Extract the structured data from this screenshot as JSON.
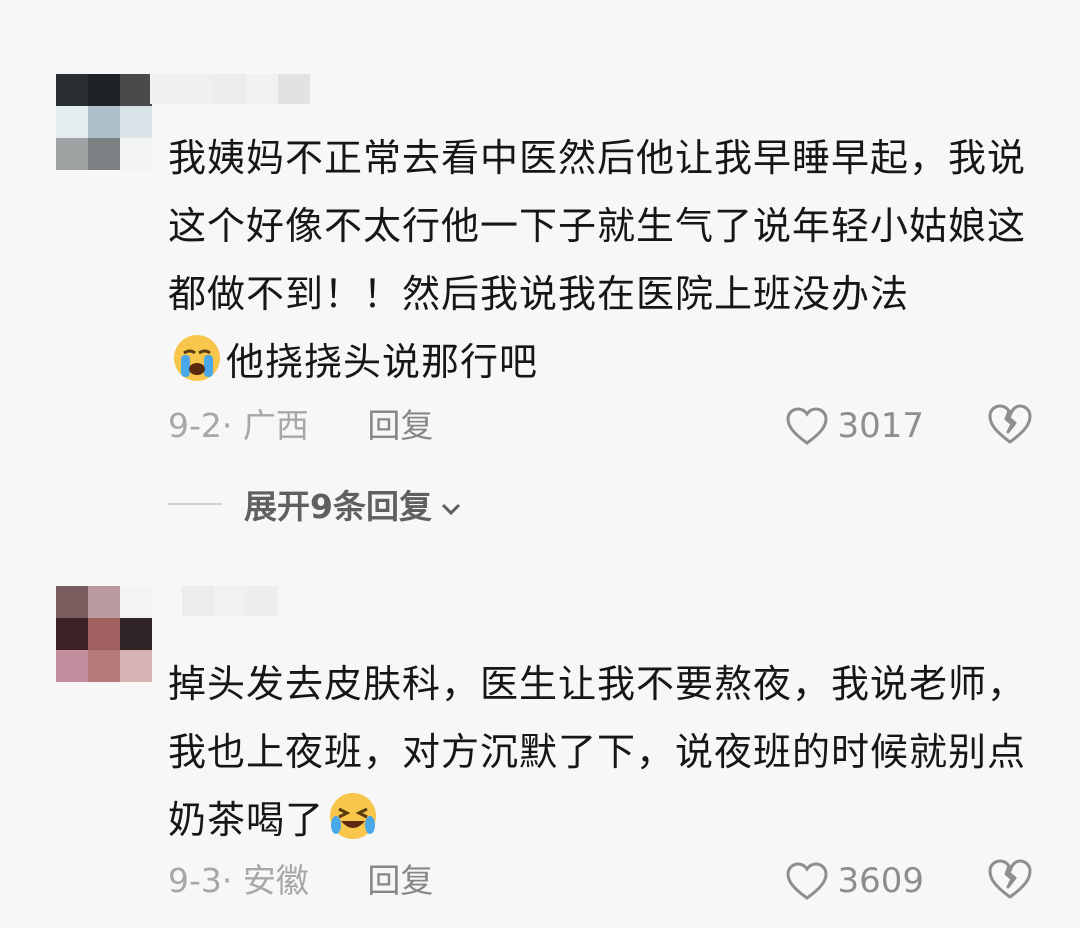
{
  "comments": [
    {
      "text_before_emoji": "我姨妈不正常去看中医然后他让我早睡早起，我说这个好像不太行他一下子就生气了说年轻小姑娘这都做不到！！然后我说我在医院上班没办法",
      "emoji_icon": "crying-face-emoji",
      "text_after_emoji": "他挠挠头说那行吧",
      "date": "9-2",
      "location": "广西",
      "reply_label": "回复",
      "likes": "3017",
      "expand_label": "展开9条回复"
    },
    {
      "text_before_emoji": "掉头发去皮肤科，医生让我不要熬夜，我说老师，我也上夜班，对方沉默了下，说夜班的时候就别点奶茶喝了",
      "emoji_icon": "laughing-crying-face-emoji",
      "text_after_emoji": "",
      "date": "9-3",
      "location": "安徽",
      "reply_label": "回复",
      "likes": "3609"
    }
  ],
  "colors": {
    "background": "#f7f7f7",
    "text": "#161616",
    "muted": "#a7a7a7",
    "emoji_yellow": "#f7c64a",
    "emoji_blue": "#4aa7e8"
  }
}
